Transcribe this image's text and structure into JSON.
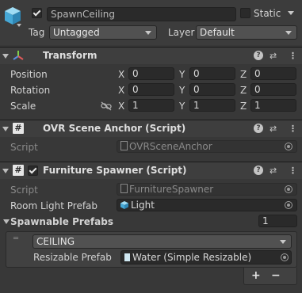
{
  "object": {
    "name": "SpawnCeiling",
    "static_label": "Static",
    "tag_label": "Tag",
    "tag_value": "Untagged",
    "layer_label": "Layer",
    "layer_value": "Default"
  },
  "transform": {
    "title": "Transform",
    "rows": [
      {
        "label": "Position",
        "x": "0",
        "y": "0",
        "z": "0"
      },
      {
        "label": "Rotation",
        "x": "0",
        "y": "0",
        "z": "0"
      },
      {
        "label": "Scale",
        "x": "1",
        "y": "1",
        "z": "1"
      }
    ],
    "axis_x": "X",
    "axis_y": "Y",
    "axis_z": "Z"
  },
  "anchor": {
    "title": "OVR Scene Anchor (Script)",
    "script_label": "Script",
    "script_value": "OVRSceneAnchor"
  },
  "spawner": {
    "title": "Furniture Spawner (Script)",
    "script_label": "Script",
    "script_value": "FurnitureSpawner",
    "room_light_label": "Room Light Prefab",
    "room_light_value": "Light",
    "spawnable_label": "Spawnable Prefabs",
    "spawnable_count": "1",
    "element": {
      "label_value": "CEILING",
      "resizable_label": "Resizable Prefab",
      "resizable_value": "Water (Simple Resizable)"
    },
    "add_label": "+",
    "remove_label": "−"
  },
  "icons": {
    "cube": "cube-icon",
    "transform": "transform-axes-icon",
    "help": "help-icon",
    "presets": "presets-icon",
    "menu": "kebab-menu-icon",
    "script": "script-hash-icon",
    "link": "constrain-proportions-icon",
    "object_picker": "object-picker-icon"
  }
}
